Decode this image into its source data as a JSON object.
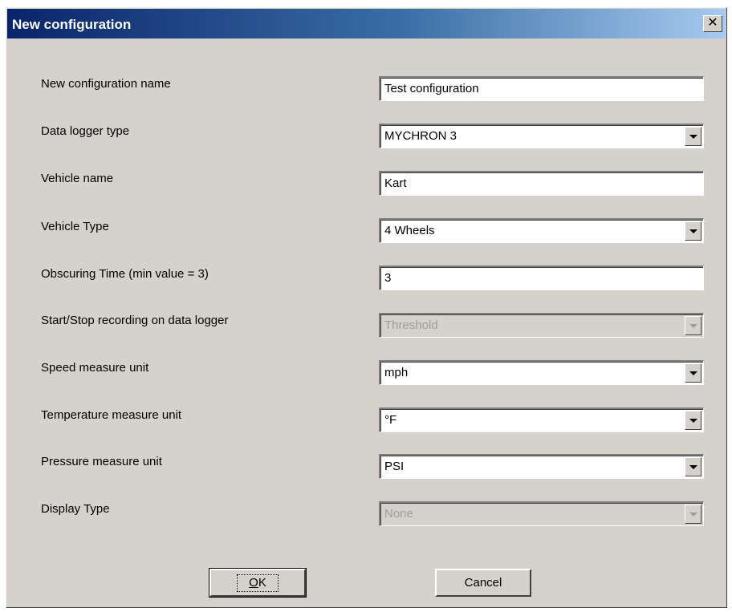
{
  "window": {
    "title": "New configuration",
    "close_glyph": "✕"
  },
  "rows": [
    {
      "label": "New configuration name",
      "value": "Test configuration",
      "kind": "text",
      "enabled": true
    },
    {
      "label": "Data logger type",
      "value": "MYCHRON 3",
      "kind": "dropdown",
      "enabled": true
    },
    {
      "label": "Vehicle name",
      "value": "Kart",
      "kind": "text",
      "enabled": true
    },
    {
      "label": "Vehicle Type",
      "value": "4 Wheels",
      "kind": "dropdown",
      "enabled": true
    },
    {
      "label": "Obscuring Time (min value = 3)",
      "value": "3",
      "kind": "text",
      "enabled": true
    },
    {
      "label": "Start/Stop recording on data logger",
      "value": "Threshold",
      "kind": "dropdown",
      "enabled": false
    },
    {
      "label": "Speed measure unit",
      "value": "mph",
      "kind": "dropdown",
      "enabled": true
    },
    {
      "label": "Temperature measure unit",
      "value": "°F",
      "kind": "dropdown",
      "enabled": true
    },
    {
      "label": "Pressure measure unit",
      "value": "PSI",
      "kind": "dropdown",
      "enabled": true
    },
    {
      "label": "Display Type",
      "value": "None",
      "kind": "dropdown",
      "enabled": false
    }
  ],
  "buttons": {
    "ok_label": "OK",
    "cancel_label": "Cancel"
  },
  "colors": {
    "dialog_face": "#d5d1cb",
    "title_start": "#0a246a",
    "title_end": "#a6caf0",
    "disabled_text": "#a09c96"
  }
}
